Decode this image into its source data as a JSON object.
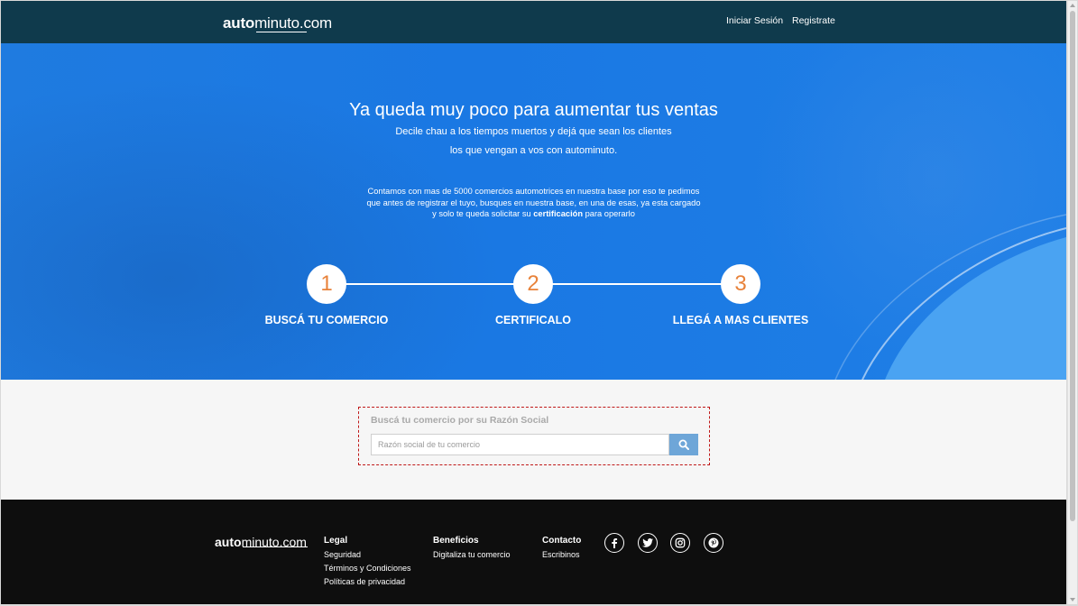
{
  "header": {
    "logo_bold": "auto",
    "logo_rest": "minuto.com",
    "nav": {
      "login": "Iniciar Sesión",
      "register": "Registrate"
    }
  },
  "hero": {
    "title": "Ya queda muy poco para aumentar tus ventas",
    "subtitle_line1": "Decile chau a los tiempos muertos y dejá que sean los clientes",
    "subtitle_line2": "los que vengan a vos con autominuto.",
    "info_line1": "Contamos con mas de 5000 comercios automotrices en nuestra base por eso te pedimos",
    "info_line2": "que antes de registrar el tuyo, busques en nuestra base, en una de esas, ya esta cargado",
    "info_line3_pre": "y solo te queda solicitar su ",
    "info_line3_bold": "certificación",
    "info_line3_post": " para operarlo",
    "steps": [
      {
        "number": "1",
        "label": "BUSCÁ TU COMERCIO"
      },
      {
        "number": "2",
        "label": "CERTIFICALO"
      },
      {
        "number": "3",
        "label": "LLEGÁ A MAS CLIENTES"
      }
    ],
    "step_number_color": "#e8823a"
  },
  "search": {
    "title": "Buscá tu comercio por su Razón Social",
    "placeholder": "Razón social de tu comercio",
    "value": "",
    "button_icon": "search-icon"
  },
  "footer": {
    "logo_bold": "auto",
    "logo_rest": "minuto.com",
    "columns": {
      "legal": {
        "title": "Legal",
        "items": [
          "Seguridad",
          "Términos y Condiciones",
          "Políticas de privacidad"
        ]
      },
      "beneficios": {
        "title": "Beneficios",
        "items": [
          "Digitaliza tu comercio"
        ]
      },
      "contacto": {
        "title": "Contacto",
        "items": [
          "Escribinos"
        ]
      }
    },
    "social_icons": [
      "facebook-icon",
      "twitter-icon",
      "instagram-icon",
      "pinterest-icon"
    ]
  },
  "colors": {
    "header_bg": "#0f3a4c",
    "hero_bg": "#1f7be0",
    "footer_bg": "#0e0e0e",
    "search_button": "#6ea6d8"
  }
}
